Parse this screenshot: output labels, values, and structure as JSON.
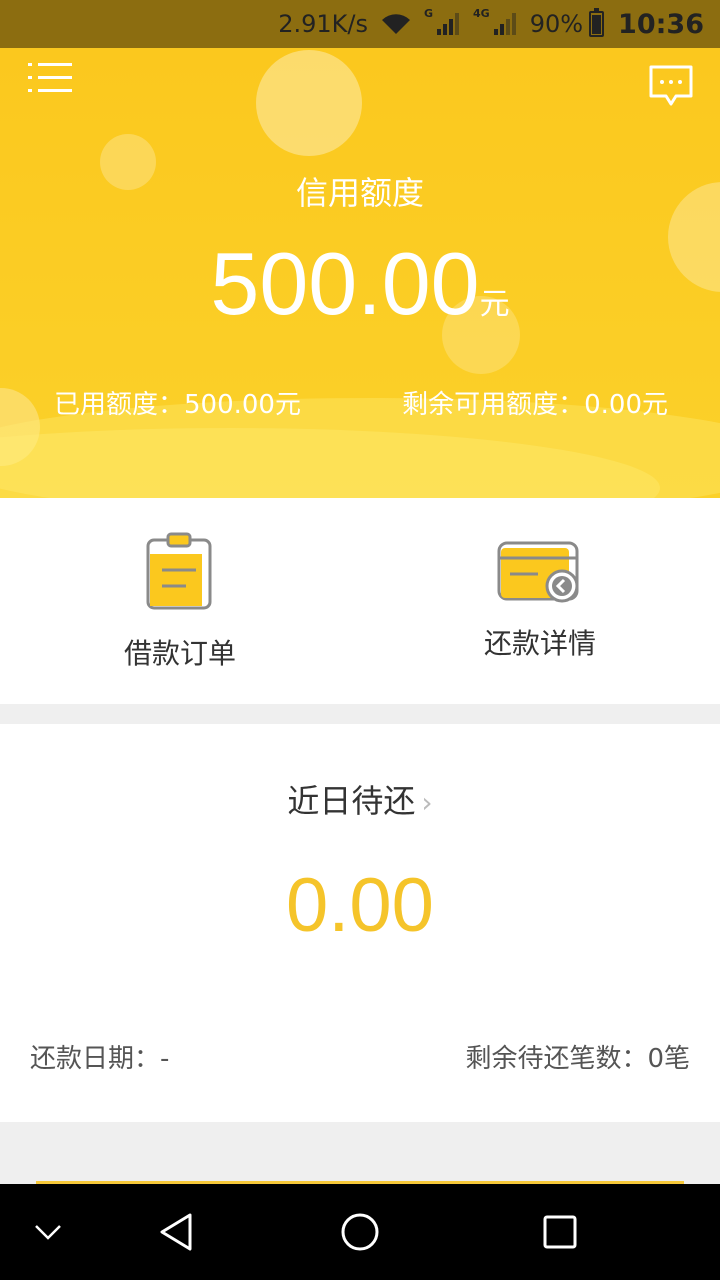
{
  "status_bar": {
    "net_speed": "2.91K/s",
    "network_g": "G",
    "network_4g": "4G",
    "battery": "90%",
    "time": "10:36"
  },
  "hero": {
    "title": "信用额度",
    "amount": "500.00",
    "unit": "元",
    "used": "已用额度：500.00元",
    "remaining": "剩余可用额度：0.00元"
  },
  "actions": {
    "loan_orders": "借款订单",
    "repay_details": "还款详情"
  },
  "due": {
    "title": "近日待还",
    "chevron": "›",
    "amount": "0.00",
    "repay_date": "还款日期：-",
    "remaining_count": "剩余待还笔数：0笔"
  },
  "colors": {
    "accent": "#fbc81e",
    "amount_yellow": "#f5c42a",
    "status_bar": "#8c6d10"
  },
  "icons": [
    "menu-icon",
    "chat-icon",
    "clipboard-icon",
    "card-icon",
    "back-chevron-icon",
    "home-icon",
    "recents-icon",
    "collapse-icon"
  ]
}
